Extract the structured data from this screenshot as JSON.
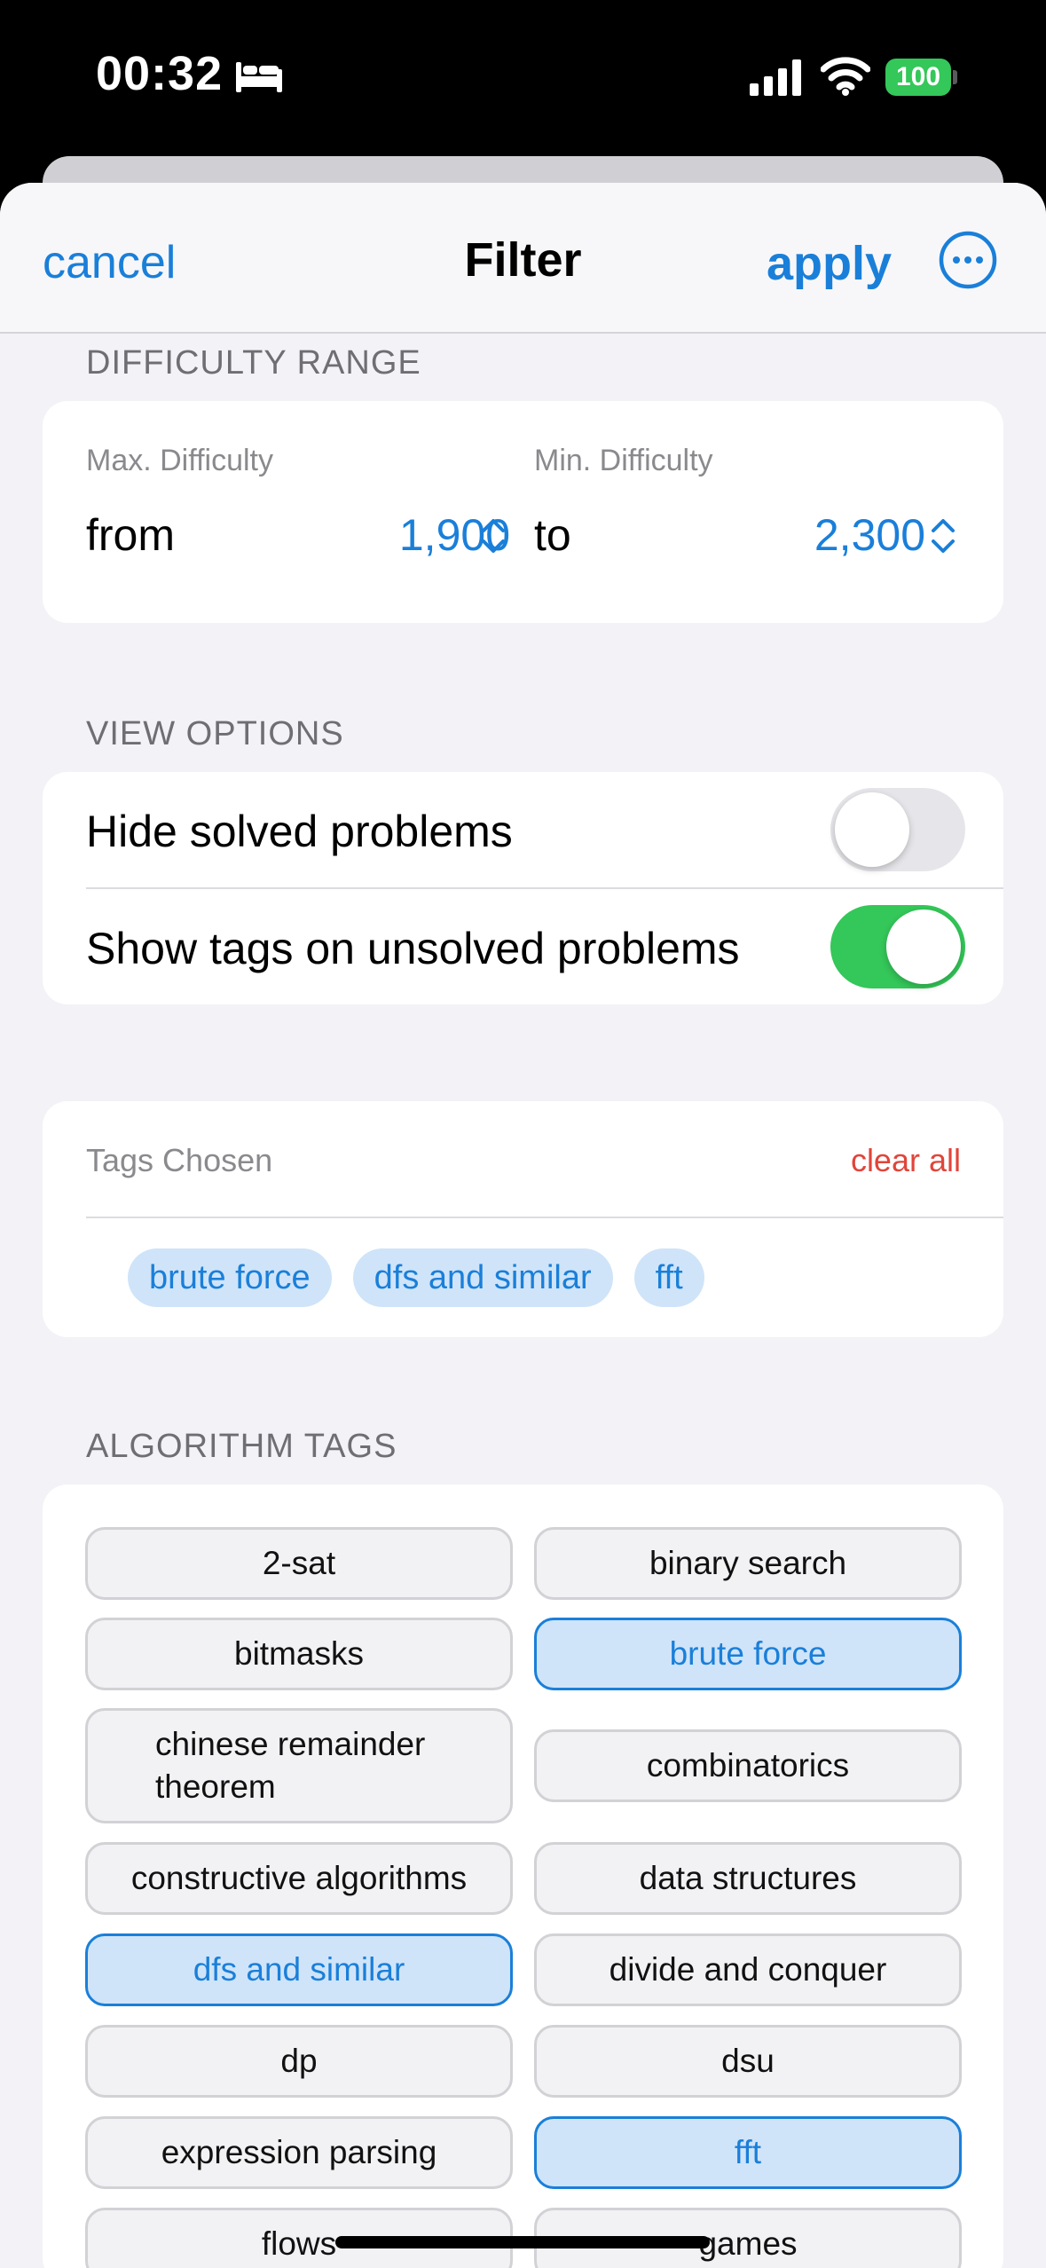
{
  "status_bar": {
    "time": "00:32",
    "battery": "100"
  },
  "nav": {
    "cancel": "cancel",
    "title": "Filter",
    "apply": "apply"
  },
  "difficulty": {
    "header": "DIFFICULTY RANGE",
    "max_label": "Max. Difficulty",
    "min_label": "Min. Difficulty",
    "from_word": "from",
    "to_word": "to",
    "from_value": "1,900",
    "to_value": "2,300"
  },
  "view_options": {
    "header": "VIEW OPTIONS",
    "items": [
      {
        "label": "Hide solved problems",
        "on": false
      },
      {
        "label": "Show tags on unsolved problems",
        "on": true
      }
    ]
  },
  "tags_chosen": {
    "title": "Tags Chosen",
    "clear_all": "clear all",
    "chips": [
      "brute force",
      "dfs and similar",
      "fft"
    ]
  },
  "algorithm_tags": {
    "header": "ALGORITHM TAGS",
    "items": [
      {
        "label": "2-sat",
        "selected": false
      },
      {
        "label": "binary search",
        "selected": false
      },
      {
        "label": "bitmasks",
        "selected": false
      },
      {
        "label": "brute force",
        "selected": true
      },
      {
        "label": "chinese remainder theorem",
        "selected": false
      },
      {
        "label": "combinatorics",
        "selected": false
      },
      {
        "label": "constructive algorithms",
        "selected": false
      },
      {
        "label": "data structures",
        "selected": false
      },
      {
        "label": "dfs and similar",
        "selected": true
      },
      {
        "label": "divide and conquer",
        "selected": false
      },
      {
        "label": "dp",
        "selected": false
      },
      {
        "label": "dsu",
        "selected": false
      },
      {
        "label": "expression parsing",
        "selected": false
      },
      {
        "label": "fft",
        "selected": true
      },
      {
        "label": "flows",
        "selected": false
      },
      {
        "label": "games",
        "selected": false
      }
    ]
  },
  "colors": {
    "accent": "#1a7fd9",
    "toggle_on": "#34c759",
    "destructive": "#e0453a",
    "selected_fill": "#cfe4f9"
  }
}
